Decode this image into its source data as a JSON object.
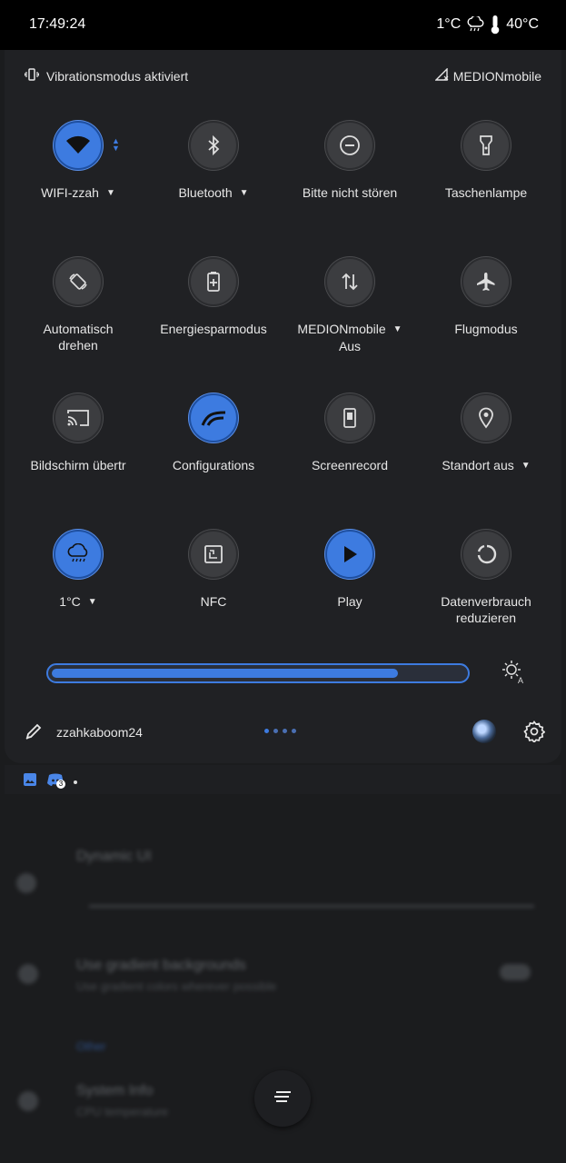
{
  "status_bar": {
    "time": "17:49:24",
    "temperature": "1°C",
    "device_temperature": "40°C"
  },
  "panel": {
    "vibration_status": "Vibrationsmodus aktiviert",
    "carrier": "MEDIONmobile"
  },
  "tiles": [
    {
      "label": "WIFI-zzah",
      "icon": "wifi-icon",
      "active": true,
      "dropdown": true
    },
    {
      "label": "Bluetooth",
      "icon": "bluetooth-icon",
      "active": false,
      "dropdown": true
    },
    {
      "label": "Bitte nicht stören",
      "icon": "do-not-disturb-icon",
      "active": false,
      "dropdown": false
    },
    {
      "label": "Taschenlampe",
      "icon": "flashlight-icon",
      "active": false,
      "dropdown": false
    },
    {
      "label": "Automatisch drehen",
      "icon": "auto-rotate-icon",
      "active": false,
      "dropdown": false
    },
    {
      "label": "Energiesparmodus",
      "icon": "battery-saver-icon",
      "active": false,
      "dropdown": false
    },
    {
      "label": "MEDIONmobile",
      "sublabel": "Aus",
      "icon": "mobile-data-icon",
      "active": false,
      "dropdown": true
    },
    {
      "label": "Flugmodus",
      "icon": "airplane-icon",
      "active": false,
      "dropdown": false
    },
    {
      "label": "Bildschirm übertr",
      "icon": "cast-icon",
      "active": false,
      "dropdown": false
    },
    {
      "label": "Configurations",
      "icon": "configurations-icon",
      "active": true,
      "dropdown": false
    },
    {
      "label": "Screenrecord",
      "icon": "screenrecord-icon",
      "active": false,
      "dropdown": false
    },
    {
      "label": "Standort aus",
      "icon": "location-icon",
      "active": false,
      "dropdown": true
    },
    {
      "label": "1°C",
      "icon": "weather-icon",
      "active": true,
      "dropdown": true
    },
    {
      "label": "NFC",
      "icon": "nfc-icon",
      "active": false,
      "dropdown": false
    },
    {
      "label": "Play",
      "icon": "play-icon",
      "active": true,
      "dropdown": false
    },
    {
      "label": "Datenverbrauch reduzieren",
      "icon": "data-saver-icon",
      "active": false,
      "dropdown": false
    }
  ],
  "brightness": {
    "level": 0.84
  },
  "footer": {
    "username": "zzahkaboom24",
    "page_count": 4,
    "current_page": 1
  },
  "notifications": {
    "discord_badge": "3"
  },
  "background_app": {
    "item1_title": "Dynamic UI",
    "item1_sub": "",
    "item2_title": "Use gradient backgrounds",
    "item2_sub": "Use gradient colors wherever possible",
    "section": "Other",
    "item3_title": "System Info",
    "item3_sub": "CPU temperature"
  },
  "colors": {
    "accent": "#3d7be0",
    "panel": "#202124",
    "background": "#1b1c1e"
  }
}
